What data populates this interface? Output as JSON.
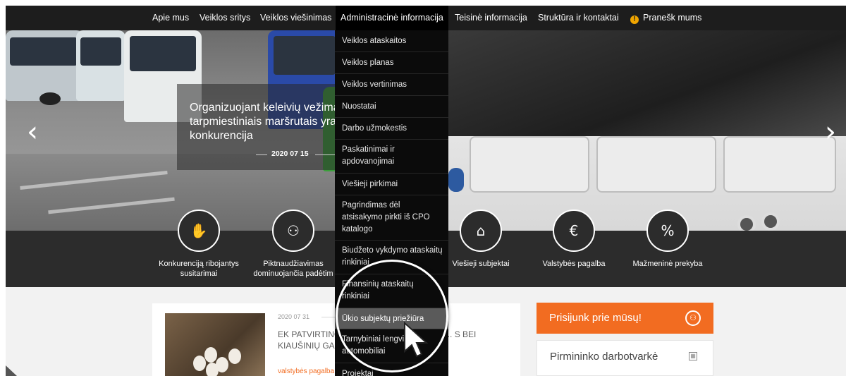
{
  "nav": {
    "items": [
      {
        "label": "Apie mus"
      },
      {
        "label": "Veiklos sritys"
      },
      {
        "label": "Veiklos viešinimas"
      },
      {
        "label": "Administracinė informacija"
      },
      {
        "label": "Teisinė informacija"
      },
      {
        "label": "Struktūra ir kontaktai"
      },
      {
        "label": "Pranešk mums"
      }
    ]
  },
  "hero": {
    "title": "Organizuojant keleivių vežimą tarpmiestiniais maršrutais yra konkurencija",
    "date": "2020 07 15"
  },
  "categories": [
    {
      "label": "Konkurenciją ribojantys susitarimai",
      "icon": "handshake-icon"
    },
    {
      "label": "Piktnaudžiavimas dominuojančia padėtim",
      "icon": "people-icon"
    },
    {
      "label": "Viešieji subjektai",
      "icon": "government-building-icon"
    },
    {
      "label": "Valstybės pagalba",
      "icon": "euro-hand-icon"
    },
    {
      "label": "Mažmeninė prekyba",
      "icon": "percent-icon"
    }
  ],
  "dropdown": {
    "items": [
      {
        "label": "Veiklos ataskaitos"
      },
      {
        "label": "Veiklos planas"
      },
      {
        "label": "Veiklos vertinimas"
      },
      {
        "label": "Nuostatai"
      },
      {
        "label": "Darbo užmokestis"
      },
      {
        "label": "Paskatinimai ir apdovanojimai"
      },
      {
        "label": "Viešieji pirkimai"
      },
      {
        "label": "Pagrindimas dėl atsisakymo pirkti iš CPO katalogo"
      },
      {
        "label": "Biudžeto vykdymo ataskaitų rinkiniai"
      },
      {
        "label": "Finansinių ataskaitų rinkiniai"
      },
      {
        "label": "Ūkio subjektų priežiūra"
      },
      {
        "label": "Tarnybiniai lengvieji automobiliai"
      },
      {
        "label": "Projektai"
      }
    ],
    "highlighted": "Ūkio subjektų priežiūra"
  },
  "news": {
    "date": "2020 07 31",
    "title": "EK PATVIRTINO ... JĄ NUO COVID-19 NUK... S BEI KIAUŠINIŲ GA... TORIŲ...",
    "tag": "valstybės pagalba"
  },
  "sidebar": {
    "join_label": "Prisijunk prie mūsų!",
    "schedule_label": "Pirmininko darbotvarkė"
  },
  "colors": {
    "accent": "#f26c21",
    "nav_bg": "#1d1d1d",
    "dropdown_bg": "#0b0b0b",
    "category_bg": "#2c2c2c",
    "warning": "#f0a500"
  }
}
